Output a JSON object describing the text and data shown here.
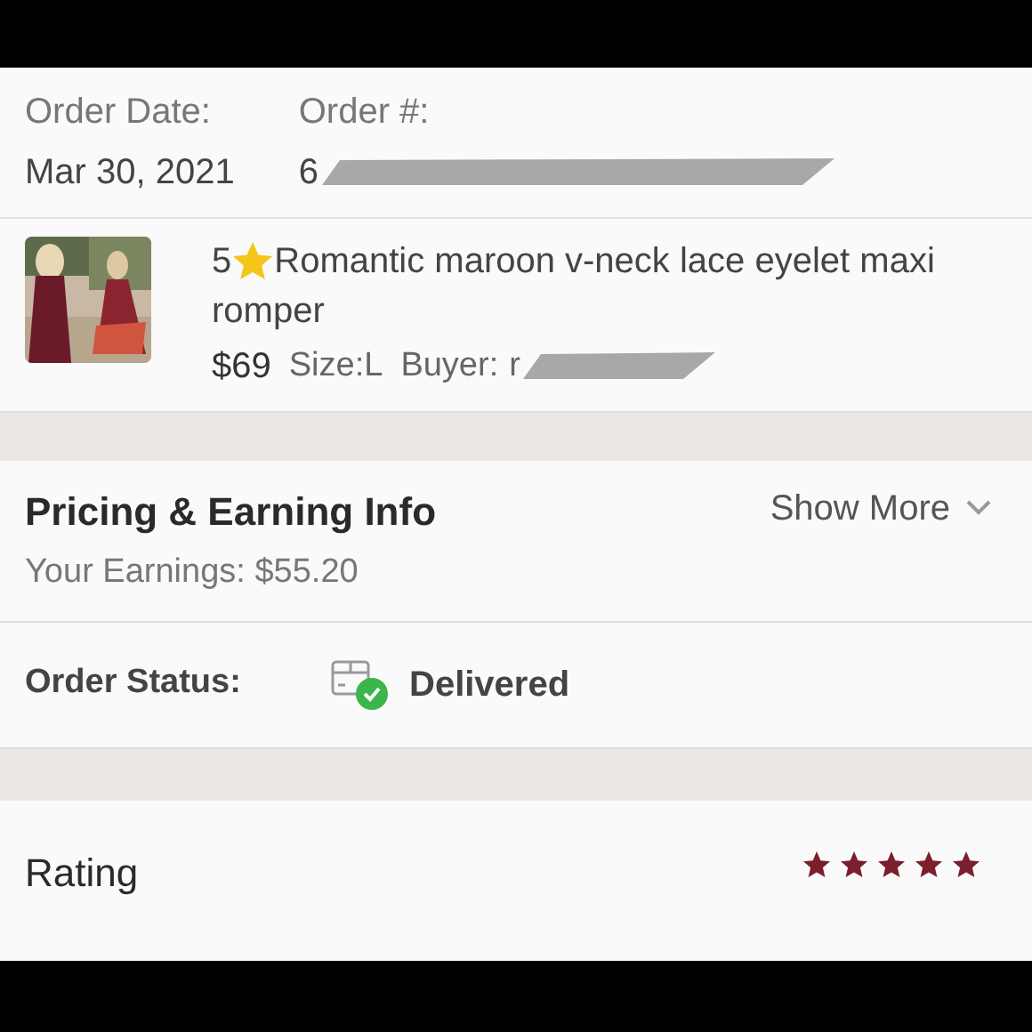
{
  "order": {
    "date_label": "Order Date:",
    "date": "Mar 30, 2021",
    "number_label": "Order #:",
    "number": "6"
  },
  "item": {
    "kind": "picture",
    "rating_prefix": "5",
    "title_lines": [
      "Romantic maroon v-neck lace eyelet maxi",
      "romper"
    ],
    "price": "$69",
    "size": "Size:L",
    "buyer_label": "Buyer:",
    "buyer": "r"
  },
  "pricing": {
    "title": "Pricing & Earning Info",
    "earnings": "Your Earnings: $55.20",
    "toggle": "Show More",
    "expanded": false
  },
  "status": {
    "label": "Order Status:",
    "value": "Delivered",
    "delivered": true
  },
  "rating": {
    "label": "Rating",
    "stars": 5
  }
}
